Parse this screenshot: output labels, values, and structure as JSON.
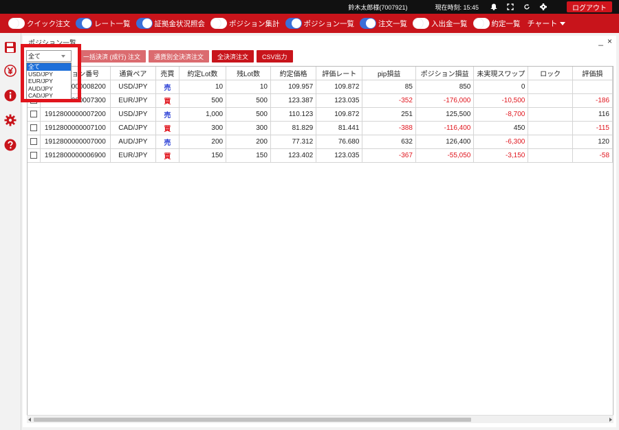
{
  "topbar": {
    "user": "鈴木太郎様(7007921)",
    "clock": "現在時刻: 15:45",
    "logout": "ログアウト"
  },
  "nav": {
    "items": [
      {
        "label": "クイック注文",
        "on": false
      },
      {
        "label": "レート一覧",
        "on": true
      },
      {
        "label": "証拠金状況照会",
        "on": true
      },
      {
        "label": "ポジション集計",
        "on": false
      },
      {
        "label": "ポジション一覧",
        "on": true
      },
      {
        "label": "注文一覧",
        "on": true
      },
      {
        "label": "入出金一覧",
        "on": false
      },
      {
        "label": "約定一覧",
        "on": false
      }
    ],
    "chart": "チャート"
  },
  "sidebar": {
    "icons": [
      "save-icon",
      "yen-icon",
      "info-icon",
      "gear-icon",
      "help-icon"
    ]
  },
  "panel": {
    "title": "ポジション一覧",
    "minimize": "_",
    "close": "×"
  },
  "toolbar": {
    "btn_bulk": "一括決済 (成行) 注文",
    "btn_pair": "通貨別全決済注文",
    "btn_all": "全決済注文",
    "btn_csv": "CSV出力"
  },
  "filter": {
    "selected": "全て",
    "options": [
      "全て",
      "USD/JPY",
      "EUR/JPY",
      "AUD/JPY",
      "CAD/JPY"
    ]
  },
  "table": {
    "headers": [
      "",
      "ポジション番号",
      "通貨ペア",
      "売買",
      "約定Lot数",
      "残Lot数",
      "約定価格",
      "評価レート",
      "pip損益",
      "ポジション損益",
      "未実現スワップ",
      "ロック",
      "評価損"
    ],
    "rows": [
      {
        "id": "1912800000008200",
        "pair": "USD/JPY",
        "side": "売",
        "lot": "10",
        "remain": "10",
        "price": "109.957",
        "rate": "109.872",
        "pip": "85",
        "pl": "850",
        "swap": "0",
        "lock": "",
        "eval": ""
      },
      {
        "id": "1912800000007300",
        "pair": "EUR/JPY",
        "side": "買",
        "lot": "500",
        "remain": "500",
        "price": "123.387",
        "rate": "123.035",
        "pip": "-352",
        "pl": "-176,000",
        "swap": "-10,500",
        "lock": "",
        "eval": "-186"
      },
      {
        "id": "1912800000007200",
        "pair": "USD/JPY",
        "side": "売",
        "lot": "1,000",
        "remain": "500",
        "price": "110.123",
        "rate": "109.872",
        "pip": "251",
        "pl": "125,500",
        "swap": "-8,700",
        "lock": "",
        "eval": "116"
      },
      {
        "id": "1912800000007100",
        "pair": "CAD/JPY",
        "side": "買",
        "lot": "300",
        "remain": "300",
        "price": "81.829",
        "rate": "81.441",
        "pip": "-388",
        "pl": "-116,400",
        "swap": "450",
        "lock": "",
        "eval": "-115"
      },
      {
        "id": "1912800000007000",
        "pair": "AUD/JPY",
        "side": "売",
        "lot": "200",
        "remain": "200",
        "price": "77.312",
        "rate": "76.680",
        "pip": "632",
        "pl": "126,400",
        "swap": "-6,300",
        "lock": "",
        "eval": "120"
      },
      {
        "id": "1912800000006900",
        "pair": "EUR/JPY",
        "side": "買",
        "lot": "150",
        "remain": "150",
        "price": "123.402",
        "rate": "123.035",
        "pip": "-367",
        "pl": "-55,050",
        "swap": "-3,150",
        "lock": "",
        "eval": "-58"
      }
    ]
  },
  "colors": {
    "brand_red": "#c8141b",
    "toggle_on": "#3a6fd8",
    "loss_red": "#e0141c",
    "sell_blue": "#2a3fd6"
  }
}
